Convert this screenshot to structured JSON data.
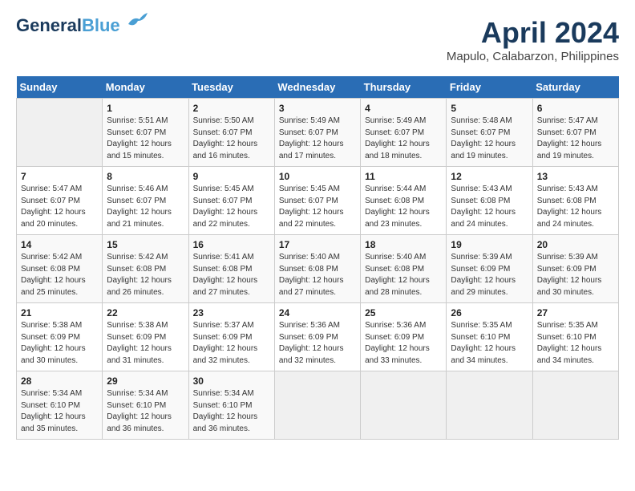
{
  "app": {
    "logo_line1": "General",
    "logo_line2": "Blue"
  },
  "header": {
    "title": "April 2024",
    "subtitle": "Mapulo, Calabarzon, Philippines"
  },
  "calendar": {
    "days_of_week": [
      "Sunday",
      "Monday",
      "Tuesday",
      "Wednesday",
      "Thursday",
      "Friday",
      "Saturday"
    ],
    "weeks": [
      [
        {
          "num": "",
          "sunrise": "",
          "sunset": "",
          "daylight": "",
          "empty": true
        },
        {
          "num": "1",
          "sunrise": "Sunrise: 5:51 AM",
          "sunset": "Sunset: 6:07 PM",
          "daylight": "Daylight: 12 hours and 15 minutes."
        },
        {
          "num": "2",
          "sunrise": "Sunrise: 5:50 AM",
          "sunset": "Sunset: 6:07 PM",
          "daylight": "Daylight: 12 hours and 16 minutes."
        },
        {
          "num": "3",
          "sunrise": "Sunrise: 5:49 AM",
          "sunset": "Sunset: 6:07 PM",
          "daylight": "Daylight: 12 hours and 17 minutes."
        },
        {
          "num": "4",
          "sunrise": "Sunrise: 5:49 AM",
          "sunset": "Sunset: 6:07 PM",
          "daylight": "Daylight: 12 hours and 18 minutes."
        },
        {
          "num": "5",
          "sunrise": "Sunrise: 5:48 AM",
          "sunset": "Sunset: 6:07 PM",
          "daylight": "Daylight: 12 hours and 19 minutes."
        },
        {
          "num": "6",
          "sunrise": "Sunrise: 5:47 AM",
          "sunset": "Sunset: 6:07 PM",
          "daylight": "Daylight: 12 hours and 19 minutes."
        }
      ],
      [
        {
          "num": "7",
          "sunrise": "Sunrise: 5:47 AM",
          "sunset": "Sunset: 6:07 PM",
          "daylight": "Daylight: 12 hours and 20 minutes."
        },
        {
          "num": "8",
          "sunrise": "Sunrise: 5:46 AM",
          "sunset": "Sunset: 6:07 PM",
          "daylight": "Daylight: 12 hours and 21 minutes."
        },
        {
          "num": "9",
          "sunrise": "Sunrise: 5:45 AM",
          "sunset": "Sunset: 6:07 PM",
          "daylight": "Daylight: 12 hours and 22 minutes."
        },
        {
          "num": "10",
          "sunrise": "Sunrise: 5:45 AM",
          "sunset": "Sunset: 6:07 PM",
          "daylight": "Daylight: 12 hours and 22 minutes."
        },
        {
          "num": "11",
          "sunrise": "Sunrise: 5:44 AM",
          "sunset": "Sunset: 6:08 PM",
          "daylight": "Daylight: 12 hours and 23 minutes."
        },
        {
          "num": "12",
          "sunrise": "Sunrise: 5:43 AM",
          "sunset": "Sunset: 6:08 PM",
          "daylight": "Daylight: 12 hours and 24 minutes."
        },
        {
          "num": "13",
          "sunrise": "Sunrise: 5:43 AM",
          "sunset": "Sunset: 6:08 PM",
          "daylight": "Daylight: 12 hours and 24 minutes."
        }
      ],
      [
        {
          "num": "14",
          "sunrise": "Sunrise: 5:42 AM",
          "sunset": "Sunset: 6:08 PM",
          "daylight": "Daylight: 12 hours and 25 minutes."
        },
        {
          "num": "15",
          "sunrise": "Sunrise: 5:42 AM",
          "sunset": "Sunset: 6:08 PM",
          "daylight": "Daylight: 12 hours and 26 minutes."
        },
        {
          "num": "16",
          "sunrise": "Sunrise: 5:41 AM",
          "sunset": "Sunset: 6:08 PM",
          "daylight": "Daylight: 12 hours and 27 minutes."
        },
        {
          "num": "17",
          "sunrise": "Sunrise: 5:40 AM",
          "sunset": "Sunset: 6:08 PM",
          "daylight": "Daylight: 12 hours and 27 minutes."
        },
        {
          "num": "18",
          "sunrise": "Sunrise: 5:40 AM",
          "sunset": "Sunset: 6:08 PM",
          "daylight": "Daylight: 12 hours and 28 minutes."
        },
        {
          "num": "19",
          "sunrise": "Sunrise: 5:39 AM",
          "sunset": "Sunset: 6:09 PM",
          "daylight": "Daylight: 12 hours and 29 minutes."
        },
        {
          "num": "20",
          "sunrise": "Sunrise: 5:39 AM",
          "sunset": "Sunset: 6:09 PM",
          "daylight": "Daylight: 12 hours and 30 minutes."
        }
      ],
      [
        {
          "num": "21",
          "sunrise": "Sunrise: 5:38 AM",
          "sunset": "Sunset: 6:09 PM",
          "daylight": "Daylight: 12 hours and 30 minutes."
        },
        {
          "num": "22",
          "sunrise": "Sunrise: 5:38 AM",
          "sunset": "Sunset: 6:09 PM",
          "daylight": "Daylight: 12 hours and 31 minutes."
        },
        {
          "num": "23",
          "sunrise": "Sunrise: 5:37 AM",
          "sunset": "Sunset: 6:09 PM",
          "daylight": "Daylight: 12 hours and 32 minutes."
        },
        {
          "num": "24",
          "sunrise": "Sunrise: 5:36 AM",
          "sunset": "Sunset: 6:09 PM",
          "daylight": "Daylight: 12 hours and 32 minutes."
        },
        {
          "num": "25",
          "sunrise": "Sunrise: 5:36 AM",
          "sunset": "Sunset: 6:09 PM",
          "daylight": "Daylight: 12 hours and 33 minutes."
        },
        {
          "num": "26",
          "sunrise": "Sunrise: 5:35 AM",
          "sunset": "Sunset: 6:10 PM",
          "daylight": "Daylight: 12 hours and 34 minutes."
        },
        {
          "num": "27",
          "sunrise": "Sunrise: 5:35 AM",
          "sunset": "Sunset: 6:10 PM",
          "daylight": "Daylight: 12 hours and 34 minutes."
        }
      ],
      [
        {
          "num": "28",
          "sunrise": "Sunrise: 5:34 AM",
          "sunset": "Sunset: 6:10 PM",
          "daylight": "Daylight: 12 hours and 35 minutes."
        },
        {
          "num": "29",
          "sunrise": "Sunrise: 5:34 AM",
          "sunset": "Sunset: 6:10 PM",
          "daylight": "Daylight: 12 hours and 36 minutes."
        },
        {
          "num": "30",
          "sunrise": "Sunrise: 5:34 AM",
          "sunset": "Sunset: 6:10 PM",
          "daylight": "Daylight: 12 hours and 36 minutes."
        },
        {
          "num": "",
          "sunrise": "",
          "sunset": "",
          "daylight": "",
          "empty": true
        },
        {
          "num": "",
          "sunrise": "",
          "sunset": "",
          "daylight": "",
          "empty": true
        },
        {
          "num": "",
          "sunrise": "",
          "sunset": "",
          "daylight": "",
          "empty": true
        },
        {
          "num": "",
          "sunrise": "",
          "sunset": "",
          "daylight": "",
          "empty": true
        }
      ]
    ]
  }
}
